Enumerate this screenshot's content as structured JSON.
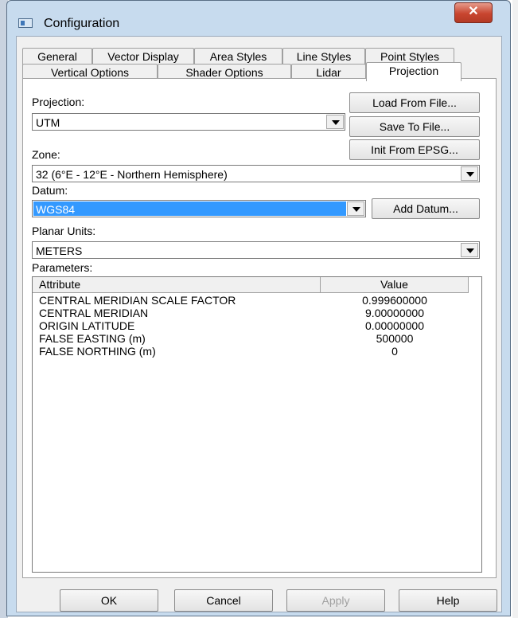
{
  "window": {
    "title": "Configuration",
    "close_label": "✕",
    "close_icon": "close-icon"
  },
  "tabs_row1": [
    "General",
    "Vector Display",
    "Area Styles",
    "Line Styles",
    "Point Styles"
  ],
  "tabs_row2": [
    "Vertical Options",
    "Shader Options",
    "Lidar",
    "Projection"
  ],
  "active_tab": "Projection",
  "projection": {
    "projection_label": "Projection:",
    "projection_value": "UTM",
    "zone_label": "Zone:",
    "zone_value": "32 (6°E - 12°E - Northern Hemisphere)",
    "datum_label": "Datum:",
    "datum_value": "WGS84",
    "planar_units_label": "Planar Units:",
    "planar_units_value": "METERS",
    "parameters_label": "Parameters:",
    "buttons": {
      "load_from_file": "Load From File...",
      "save_to_file": "Save To File...",
      "init_from_epsg": "Init From EPSG...",
      "add_datum": "Add Datum..."
    }
  },
  "parameters": {
    "columns": [
      "Attribute",
      "Value"
    ],
    "rows": [
      {
        "attribute": "CENTRAL MERIDIAN SCALE FACTOR",
        "value": "0.999600000"
      },
      {
        "attribute": "CENTRAL MERIDIAN",
        "value": "9.00000000"
      },
      {
        "attribute": "ORIGIN LATITUDE",
        "value": "0.00000000"
      },
      {
        "attribute": "FALSE EASTING (m)",
        "value": "500000"
      },
      {
        "attribute": "FALSE NORTHING (m)",
        "value": "0"
      }
    ]
  },
  "footer": {
    "ok": "OK",
    "cancel": "Cancel",
    "apply": "Apply",
    "help": "Help"
  },
  "colors": {
    "selection": "#3399ff",
    "window_frame": "#c7dbee",
    "close_button": "#c8452f"
  }
}
